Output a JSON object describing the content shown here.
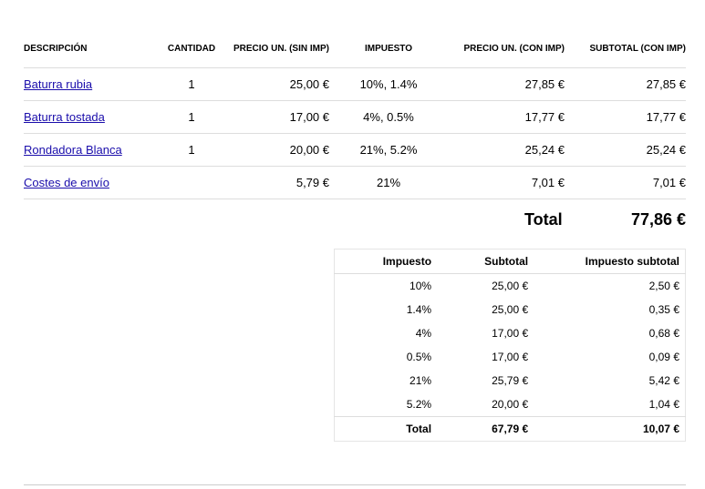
{
  "items_table": {
    "headers": [
      "DESCRIPCIÓN",
      "CANTIDAD",
      "PRECIO UN. (SIN IMP)",
      "IMPUESTO",
      "PRECIO UN. (CON IMP)",
      "SUBTOTAL (CON IMP)"
    ],
    "rows": [
      {
        "descripcion": "Baturra rubia",
        "cantidad": "1",
        "precio_sin": "25,00 €",
        "impuesto": "10%, 1.4%",
        "precio_con": "27,85 €",
        "subtotal": "27,85 €"
      },
      {
        "descripcion": "Baturra tostada",
        "cantidad": "1",
        "precio_sin": "17,00 €",
        "impuesto": "4%, 0.5%",
        "precio_con": "17,77 €",
        "subtotal": "17,77 €"
      },
      {
        "descripcion": "Rondadora Blanca",
        "cantidad": "1",
        "precio_sin": "20,00 €",
        "impuesto": "21%, 5.2%",
        "precio_con": "25,24 €",
        "subtotal": "25,24 €"
      },
      {
        "descripcion": "Costes de envío",
        "cantidad": "",
        "precio_sin": "5,79 €",
        "impuesto": "21%",
        "precio_con": "7,01 €",
        "subtotal": "7,01 €"
      }
    ]
  },
  "total": {
    "label": "Total",
    "value": "77,86 €"
  },
  "tax_table": {
    "headers": [
      "Impuesto",
      "Subtotal",
      "Impuesto subtotal"
    ],
    "rows": [
      {
        "impuesto": "10%",
        "subtotal": "25,00 €",
        "impuesto_subtotal": "2,50 €"
      },
      {
        "impuesto": "1.4%",
        "subtotal": "25,00 €",
        "impuesto_subtotal": "0,35 €"
      },
      {
        "impuesto": "4%",
        "subtotal": "17,00 €",
        "impuesto_subtotal": "0,68 €"
      },
      {
        "impuesto": "0.5%",
        "subtotal": "17,00 €",
        "impuesto_subtotal": "0,09 €"
      },
      {
        "impuesto": "21%",
        "subtotal": "25,79 €",
        "impuesto_subtotal": "5,42 €"
      },
      {
        "impuesto": "5.2%",
        "subtotal": "20,00 €",
        "impuesto_subtotal": "1,04 €"
      }
    ],
    "footer": {
      "label": "Total",
      "subtotal": "67,79 €",
      "impuesto_subtotal": "10,07 €"
    }
  }
}
